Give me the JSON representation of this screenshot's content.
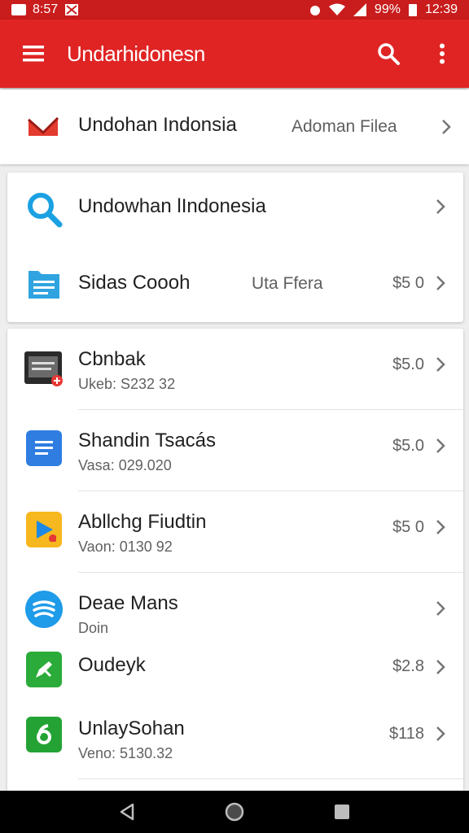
{
  "status_bar": {
    "time_left": "8:57",
    "battery": "99%",
    "time": "12:39"
  },
  "app_bar": {
    "title": "Undarhidonesn",
    "accent": "#e02424"
  },
  "header_row": {
    "title": "Undohan Indonsia",
    "action": "Adoman Filea"
  },
  "search_card": {
    "items": [
      {
        "title": "Undowhan lIndonesia",
        "icon": "search-icon"
      },
      {
        "title": "Sidas Coooh",
        "middle": "Uta Ffera",
        "price": "$5 0",
        "icon": "document-icon"
      }
    ]
  },
  "list": {
    "items": [
      {
        "title": "Cbnbak",
        "subtitle": "Ukeb: S232 32",
        "price": "$5.0",
        "icon": "video-app-icon"
      },
      {
        "title": "Shandin Tsacás",
        "subtitle": "Vasa: 029.020",
        "price": "$5.0",
        "icon": "docs-app-icon"
      },
      {
        "title": "Abllchg Fiudtin",
        "subtitle": "Vaon: 0130 92",
        "price": "$5 0",
        "icon": "play-app-icon"
      },
      {
        "title": "Deae Mans",
        "subtitle": "Doin",
        "price": "",
        "icon": "wave-app-icon"
      },
      {
        "title": "Oudeyk",
        "subtitle": "",
        "price": "$2.8",
        "icon": "pen-app-icon"
      },
      {
        "title": "UnlaySohan",
        "subtitle": "Veno: 5130.32",
        "price": "$118",
        "icon": "six-app-icon"
      }
    ]
  }
}
